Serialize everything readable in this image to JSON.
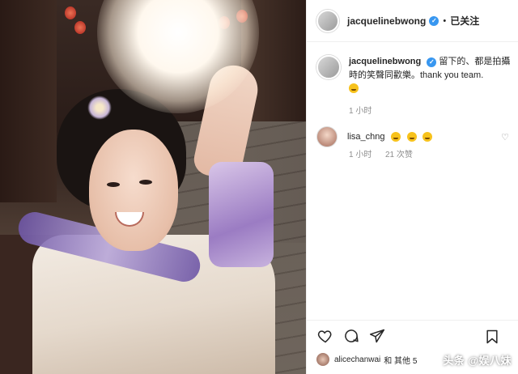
{
  "post": {
    "author": {
      "username": "jacquelinebwong",
      "verified_icon": "verified-badge-icon",
      "follow_separator": "•",
      "follow_label": "已关注"
    },
    "caption": {
      "username": "jacquelinebwong",
      "text": "留下的、都是拍攝時的笑聲同歡樂。thank you team.",
      "emoji": "smiling-face-emoji",
      "time": "1 小时"
    },
    "comments": [
      {
        "username": "lisa_chng",
        "emojis": [
          "smiling-face-emoji",
          "smiling-face-emoji",
          "smiling-face-emoji"
        ],
        "time": "1 小时",
        "likes": "21 次赞"
      }
    ],
    "actions": {
      "like_icon": "heart-icon",
      "comment_icon": "comment-icon",
      "share_icon": "share-icon",
      "save_icon": "bookmark-icon"
    },
    "liked_by": {
      "username": "alicechanwai",
      "text": "和 其他 5"
    },
    "watermark": "头条 @娱八妹"
  },
  "colors": {
    "verified": "#3897f0",
    "text": "#262626",
    "muted": "#8e8e8e",
    "border": "#efefef"
  }
}
